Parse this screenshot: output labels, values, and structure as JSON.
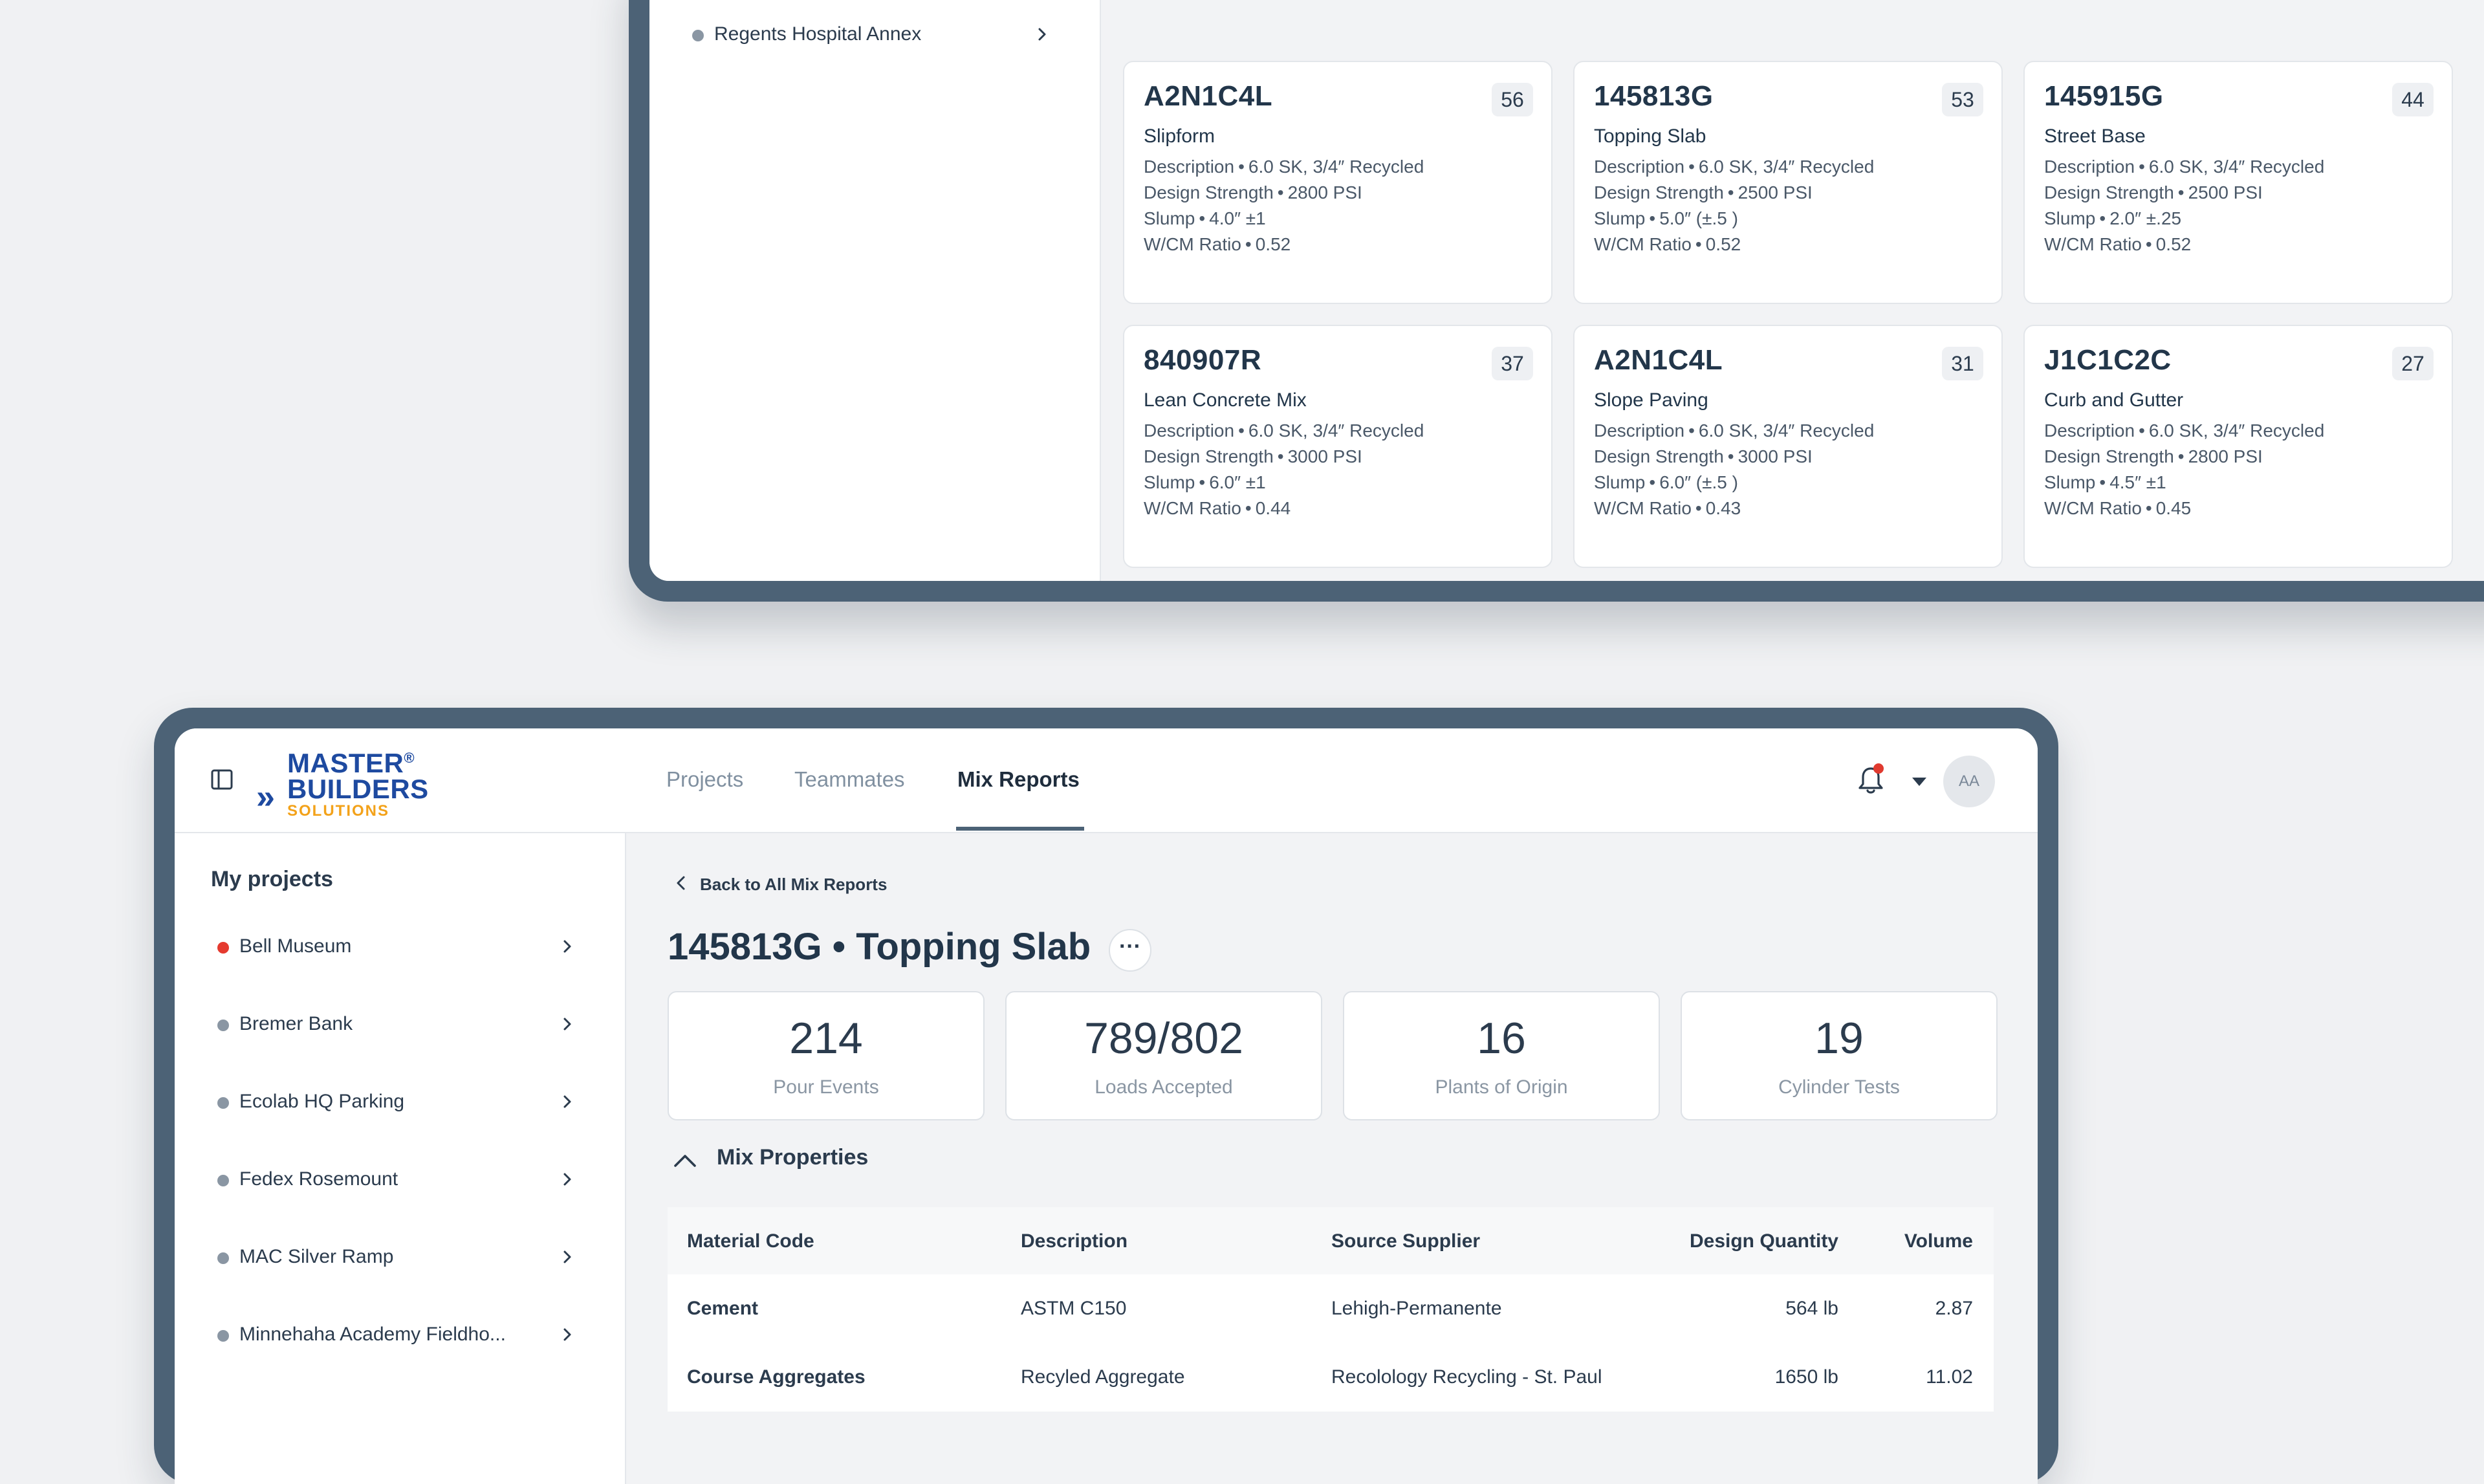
{
  "back_device": {
    "sidebar_project": "Regents Hospital Annex",
    "mix_cards": [
      {
        "code": "A2N1C4L",
        "count": "56",
        "name": "Slipform",
        "description_label": "Description",
        "description": "6.0 SK, 3/4″ Recycled",
        "strength_label": "Design Strength",
        "strength": "2800 PSI",
        "slump_label": "Slump",
        "slump": "4.0″ ±1",
        "wcm_label": "W/CM Ratio",
        "wcm": "0.52"
      },
      {
        "code": "145813G",
        "count": "53",
        "name": "Topping Slab",
        "description_label": "Description",
        "description": "6.0 SK, 3/4″ Recycled",
        "strength_label": "Design Strength",
        "strength": "2500 PSI",
        "slump_label": "Slump",
        "slump": "5.0″ (±.5 )",
        "wcm_label": "W/CM Ratio",
        "wcm": "0.52"
      },
      {
        "code": "145915G",
        "count": "44",
        "name": "Street Base",
        "description_label": "Description",
        "description": "6.0 SK, 3/4″ Recycled",
        "strength_label": "Design Strength",
        "strength": "2500 PSI",
        "slump_label": "Slump",
        "slump": "2.0″ ±.25",
        "wcm_label": "W/CM Ratio",
        "wcm": "0.52"
      },
      {
        "code": "840907R",
        "count": "37",
        "name": "Lean Concrete Mix",
        "description_label": "Description",
        "description": "6.0 SK, 3/4″ Recycled",
        "strength_label": "Design Strength",
        "strength": "3000 PSI",
        "slump_label": "Slump",
        "slump": "6.0″ ±1",
        "wcm_label": "W/CM Ratio",
        "wcm": "0.44"
      },
      {
        "code": "A2N1C4L",
        "count": "31",
        "name": "Slope Paving",
        "description_label": "Description",
        "description": "6.0 SK, 3/4″ Recycled",
        "strength_label": "Design Strength",
        "strength": "3000 PSI",
        "slump_label": "Slump",
        "slump": "6.0″ (±.5 )",
        "wcm_label": "W/CM Ratio",
        "wcm": "0.43"
      },
      {
        "code": "J1C1C2C",
        "count": "27",
        "name": "Curb and Gutter",
        "description_label": "Description",
        "description": "6.0 SK, 3/4″ Recycled",
        "strength_label": "Design Strength",
        "strength": "2800 PSI",
        "slump_label": "Slump",
        "slump": "4.5″ ±1",
        "wcm_label": "W/CM Ratio",
        "wcm": "0.45"
      }
    ]
  },
  "header": {
    "logo": {
      "line1": "MASTER",
      "reg": "®",
      "line2": "BUILDERS",
      "line3": "SOLUTIONS",
      "chevrons": "»"
    },
    "tabs": [
      {
        "label": "Projects",
        "active": false
      },
      {
        "label": "Teammates",
        "active": false
      },
      {
        "label": "Mix Reports",
        "active": true
      }
    ],
    "avatar_initials": "AA",
    "notification_icon": "bell-icon",
    "accent_color": "#4c6276",
    "alert_color": "#e03a2f"
  },
  "sidebar": {
    "title": "My projects",
    "projects": [
      {
        "label": "Bell Museum",
        "status": "alert"
      },
      {
        "label": "Bremer Bank",
        "status": "normal"
      },
      {
        "label": "Ecolab HQ Parking",
        "status": "normal"
      },
      {
        "label": "Fedex Rosemount",
        "status": "normal"
      },
      {
        "label": "MAC Silver Ramp",
        "status": "normal"
      },
      {
        "label": "Minnehaha Academy Fieldho...",
        "status": "normal"
      }
    ]
  },
  "main": {
    "back_link": "Back to All Mix Reports",
    "title": "145813G • Topping Slab",
    "more_label": "···",
    "stats": [
      {
        "value": "214",
        "label": "Pour Events"
      },
      {
        "value": "789/802",
        "label": "Loads Accepted"
      },
      {
        "value": "16",
        "label": "Plants of Origin"
      },
      {
        "value": "19",
        "label": "Cylinder Tests"
      }
    ],
    "section_title": "Mix Properties",
    "table": {
      "headers": [
        "Material Code",
        "Description",
        "Source Supplier",
        "Design Quantity",
        "Volume"
      ],
      "rows": [
        [
          "Cement",
          "ASTM C150",
          "Lehigh-Permanente",
          "564 lb",
          "2.87"
        ],
        [
          "Course Aggregates",
          "Recyled Aggregate",
          "Recolology Recycling - St. Paul",
          "1650 lb",
          "11.02"
        ]
      ]
    }
  }
}
